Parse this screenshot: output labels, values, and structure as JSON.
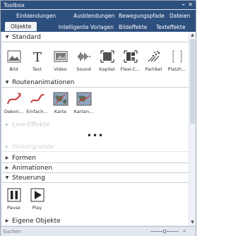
{
  "window": {
    "title": "Toolbox",
    "controls": [
      "pin-icon",
      "close-icon"
    ]
  },
  "tabs": {
    "row1": [
      "Einblendungen",
      "Ausblendungen",
      "Bewegungspfade",
      "Dateien"
    ],
    "row2": [
      "Objekte",
      "Intelligente Vorlagen",
      "Bildeffekte",
      "Texteffekte"
    ],
    "active": "Objekte"
  },
  "sections": {
    "standard": {
      "label": "Standard",
      "items": [
        "Bild",
        "Text",
        "Video",
        "Sound",
        "Kapitel",
        "Flexi-C...",
        "Partikel",
        "Platzh..."
      ]
    },
    "routen": {
      "label": "Routenanimationen",
      "items": [
        "Dekori...",
        "Einfach...",
        "Karte",
        "Karten..."
      ]
    },
    "live": {
      "label": "Live-Effekte"
    },
    "hintergruende": {
      "label": "Hintergründe"
    },
    "formen": {
      "label": "Formen"
    },
    "animationen": {
      "label": "Animationen"
    },
    "steuerung": {
      "label": "Steuerung",
      "items": [
        "Pause",
        "Play"
      ]
    },
    "eigene": {
      "label": "Eigene Objekte"
    }
  },
  "dots": "•••",
  "search": {
    "placeholder": "Suchen",
    "value": ""
  },
  "icons": {
    "bild": "image-icon",
    "text": "text-icon",
    "video": "video-icon",
    "sound": "sound-icon",
    "kapitel": "chapter-icon",
    "flexi": "flexi-collage-icon",
    "partikel": "particle-icon",
    "platzhalter": "placeholder-icon",
    "search": "search-icon"
  },
  "colors": {
    "accent": "#2d4f7e",
    "route_red": "#c83838",
    "route_blue": "#3a6db5"
  }
}
